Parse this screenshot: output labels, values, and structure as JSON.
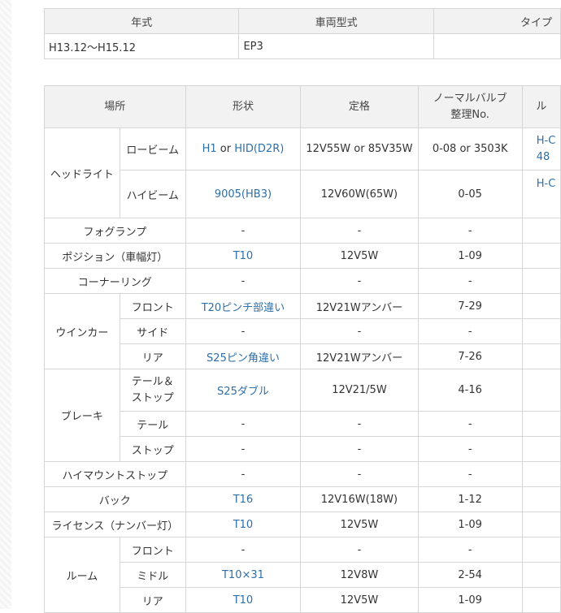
{
  "vehicle_table": {
    "headers": [
      "年式",
      "車両型式",
      "タイプ"
    ],
    "row": [
      "H13.12〜H15.12",
      "EP3",
      ""
    ]
  },
  "bulb_table": {
    "headers": {
      "location": "場所",
      "shape": "形状",
      "rating": "定格",
      "normal_bulb_line1": "ノーマルバルブ",
      "normal_bulb_line2": "整理No.",
      "partial_col": "ル"
    },
    "headlight": {
      "group": "ヘッドライト",
      "low": {
        "name": "ロービーム",
        "shape_a": "H1",
        "shape_or": " or ",
        "shape_b": "HID(D2R)",
        "rating": "12V55W or 85V35W",
        "no": "0-08 or 3503K",
        "extra_line1": "H-C",
        "extra_line2": "48"
      },
      "high": {
        "name": "ハイビーム",
        "shape": "9005(HB3)",
        "rating": "12V60W(65W)",
        "no": "0-05",
        "extra": "H-C"
      }
    },
    "fog": {
      "name": "フォグランプ",
      "shape": "-",
      "rating": "-",
      "no": "-"
    },
    "position": {
      "name": "ポジション（車幅灯）",
      "shape": "T10",
      "rating": "12V5W",
      "no": "1-09"
    },
    "cornering": {
      "name": "コーナーリング",
      "shape": "-",
      "rating": "-",
      "no": "-"
    },
    "winker": {
      "group": "ウインカー",
      "front": {
        "name": "フロント",
        "shape": "T20ピンチ部違い",
        "rating": "12V21Wアンバー",
        "no": "7-29"
      },
      "side": {
        "name": "サイド",
        "shape": "-",
        "rating": "-",
        "no": "-"
      },
      "rear": {
        "name": "リア",
        "shape": "S25ピン角違い",
        "rating": "12V21Wアンバー",
        "no": "7-26"
      }
    },
    "brake": {
      "group": "ブレーキ",
      "tail_stop": {
        "name_line1": "テール＆",
        "name_line2": "ストップ",
        "shape": "S25ダブル",
        "rating": "12V21/5W",
        "no": "4-16"
      },
      "tail": {
        "name": "テール",
        "shape": "-",
        "rating": "-",
        "no": "-"
      },
      "stop": {
        "name": "ストップ",
        "shape": "-",
        "rating": "-",
        "no": "-"
      }
    },
    "high_mount": {
      "name": "ハイマウントストップ",
      "shape": "-",
      "rating": "-",
      "no": "-"
    },
    "back": {
      "name": "バック",
      "shape": "T16",
      "rating": "12V16W(18W)",
      "no": "1-12"
    },
    "license": {
      "name": "ライセンス（ナンバー灯）",
      "shape": "T10",
      "rating": "12V5W",
      "no": "1-09"
    },
    "room": {
      "group": "ルーム",
      "front": {
        "name": "フロント",
        "shape": "-",
        "rating": "-",
        "no": "-"
      },
      "middle": {
        "name": "ミドル",
        "shape": "T10×31",
        "rating": "12V8W",
        "no": "2-54"
      },
      "rear": {
        "name": "リア",
        "shape": "T10",
        "rating": "12V5W",
        "no": "1-09"
      }
    }
  }
}
